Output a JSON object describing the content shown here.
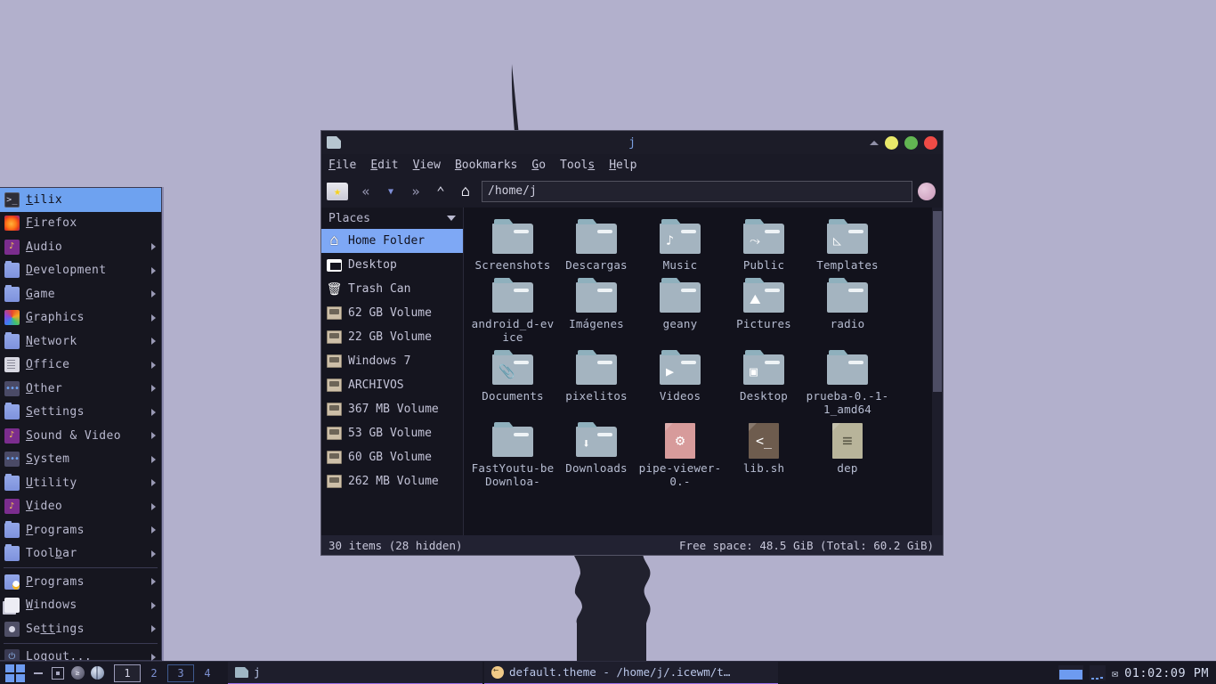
{
  "desktop": {
    "wallpaper_bg": "#b2b0cc",
    "wallpaper_silhouette": "#21212e"
  },
  "start_menu": {
    "items": [
      {
        "label": "tilix",
        "icon": "terminal-icon",
        "submenu": false,
        "selected": true,
        "accel": "t"
      },
      {
        "label": "Firefox",
        "icon": "firefox-icon",
        "submenu": false,
        "selected": false,
        "accel": "F"
      },
      {
        "label": "Audio",
        "icon": "media-icon",
        "submenu": true,
        "selected": false,
        "accel": "A"
      },
      {
        "label": "Development",
        "icon": "folder-icon",
        "submenu": true,
        "selected": false,
        "accel": "D"
      },
      {
        "label": "Game",
        "icon": "folder-icon",
        "submenu": true,
        "selected": false,
        "accel": "G"
      },
      {
        "label": "Graphics",
        "icon": "graphics-icon",
        "submenu": true,
        "selected": false,
        "accel": "G"
      },
      {
        "label": "Network",
        "icon": "folder-icon",
        "submenu": true,
        "selected": false,
        "accel": "N"
      },
      {
        "label": "Office",
        "icon": "document-icon",
        "submenu": true,
        "selected": false,
        "accel": "O"
      },
      {
        "label": "Other",
        "icon": "dots-icon",
        "submenu": true,
        "selected": false,
        "accel": "O"
      },
      {
        "label": "Settings",
        "icon": "folder-icon",
        "submenu": true,
        "selected": false,
        "accel": "S"
      },
      {
        "label": "Sound & Video",
        "icon": "media-icon",
        "submenu": true,
        "selected": false,
        "accel": "S"
      },
      {
        "label": "System",
        "icon": "dots-icon",
        "submenu": true,
        "selected": false,
        "accel": "S"
      },
      {
        "label": "Utility",
        "icon": "folder-icon",
        "submenu": true,
        "selected": false,
        "accel": "U"
      },
      {
        "label": "Video",
        "icon": "media-icon",
        "submenu": true,
        "selected": false,
        "accel": "V"
      },
      {
        "label": "Programs",
        "icon": "folder-icon",
        "submenu": true,
        "selected": false,
        "accel": "P"
      },
      {
        "label": "Toolbar",
        "icon": "folder-icon",
        "submenu": true,
        "selected": false,
        "accel": "b"
      },
      {
        "label": "Programs",
        "icon": "programs-tux-icon",
        "submenu": true,
        "selected": false,
        "accel": "P"
      },
      {
        "label": "Windows",
        "icon": "windows-icon",
        "submenu": true,
        "selected": false,
        "accel": "W"
      },
      {
        "label": "Settings",
        "icon": "gear-icon",
        "submenu": true,
        "selected": false,
        "accel": "tt"
      },
      {
        "label": "Logout...",
        "icon": "logout-icon",
        "submenu": true,
        "selected": false,
        "accel": "L"
      }
    ]
  },
  "file_manager": {
    "title": "j",
    "titlebar_buttons": {
      "rollup": "▲",
      "minimize": "minimize",
      "maximize": "maximize",
      "close": "close"
    },
    "menubar": [
      "File",
      "Edit",
      "View",
      "Bookmarks",
      "Go",
      "Tools",
      "Help"
    ],
    "toolbar": {
      "bookmark_label": "bookmark-star",
      "back_label": "«",
      "history_label": "▼",
      "forward_label": "»",
      "up_label": "⌃",
      "home_label": "⌂",
      "path_value": "/home/j",
      "path_placeholder": "/home/j",
      "right_icon": "globe-icon"
    },
    "places": {
      "header": "Places",
      "items": [
        {
          "label": "Home Folder",
          "icon": "home-icon",
          "selected": true
        },
        {
          "label": "Desktop",
          "icon": "desktop-icon",
          "selected": false
        },
        {
          "label": "Trash Can",
          "icon": "trash-icon",
          "selected": false
        },
        {
          "label": "62 GB Volume",
          "icon": "drive-icon",
          "selected": false
        },
        {
          "label": "22 GB Volume",
          "icon": "drive-icon",
          "selected": false
        },
        {
          "label": "Windows 7",
          "icon": "drive-icon",
          "selected": false
        },
        {
          "label": "ARCHIVOS",
          "icon": "drive-icon",
          "selected": false
        },
        {
          "label": "367 MB Volume",
          "icon": "drive-icon",
          "selected": false
        },
        {
          "label": "53 GB Volume",
          "icon": "drive-icon",
          "selected": false
        },
        {
          "label": "60 GB Volume",
          "icon": "drive-icon",
          "selected": false
        },
        {
          "label": "262 MB Volume",
          "icon": "drive-icon",
          "selected": false
        }
      ]
    },
    "files": [
      {
        "name": "Screenshots",
        "type": "folder",
        "emblem": ""
      },
      {
        "name": "Descargas",
        "type": "folder",
        "emblem": ""
      },
      {
        "name": "Music",
        "type": "folder",
        "emblem": "♪"
      },
      {
        "name": "Public",
        "type": "folder",
        "emblem": "⤳"
      },
      {
        "name": "Templates",
        "type": "folder",
        "emblem": "◺"
      },
      {
        "name": "android_d-evice",
        "type": "folder",
        "emblem": ""
      },
      {
        "name": "Imágenes",
        "type": "folder",
        "emblem": ""
      },
      {
        "name": "geany",
        "type": "folder",
        "emblem": ""
      },
      {
        "name": "Pictures",
        "type": "folder",
        "emblem": "⛰"
      },
      {
        "name": "radio",
        "type": "folder",
        "emblem": ""
      },
      {
        "name": "Documents",
        "type": "folder",
        "emblem": "📎"
      },
      {
        "name": "pixelitos",
        "type": "folder",
        "emblem": ""
      },
      {
        "name": "Videos",
        "type": "folder",
        "emblem": "▶"
      },
      {
        "name": "Desktop",
        "type": "folder",
        "emblem": "▣"
      },
      {
        "name": "prueba-0.-1-1_amd64",
        "type": "folder",
        "emblem": ""
      },
      {
        "name": "FastYoutu-beDownloa-",
        "type": "folder",
        "emblem": ""
      },
      {
        "name": "Downloads",
        "type": "folder",
        "emblem": "⬇"
      },
      {
        "name": "pipe-viewer-0.-",
        "type": "file",
        "color": "pink",
        "glyph": "⚙"
      },
      {
        "name": "lib.sh",
        "type": "file",
        "color": "brown",
        "glyph": "<_"
      },
      {
        "name": "dep",
        "type": "file",
        "color": "tan",
        "glyph": "≡"
      }
    ],
    "status": {
      "left": "30 items (28 hidden)",
      "right": "Free space: 48.5 GiB (Total: 60.2 GiB)"
    }
  },
  "taskbar": {
    "start_icon": "start-menu-icon",
    "system_buttons": [
      "minimize-all-icon",
      "show-desktop-icon",
      "terminal-orb-icon",
      "browser-globe-icon"
    ],
    "workspaces": [
      {
        "label": "1",
        "active": true,
        "boxed": true
      },
      {
        "label": "2",
        "active": false,
        "boxed": false
      },
      {
        "label": "3",
        "active": false,
        "boxed": true
      },
      {
        "label": "4",
        "active": false,
        "boxed": false
      }
    ],
    "tasks": [
      {
        "label": "j",
        "icon": "folder-icon"
      },
      {
        "label": "default.theme - /home/j/.icewm/t…",
        "icon": "theme-icon"
      }
    ],
    "tray": {
      "monitor_icon": "net-monitor-icon",
      "cpu_icon": "cpu-monitor-icon",
      "mail_icon": "mail-icon",
      "clock": "01:02:09 PM"
    }
  }
}
